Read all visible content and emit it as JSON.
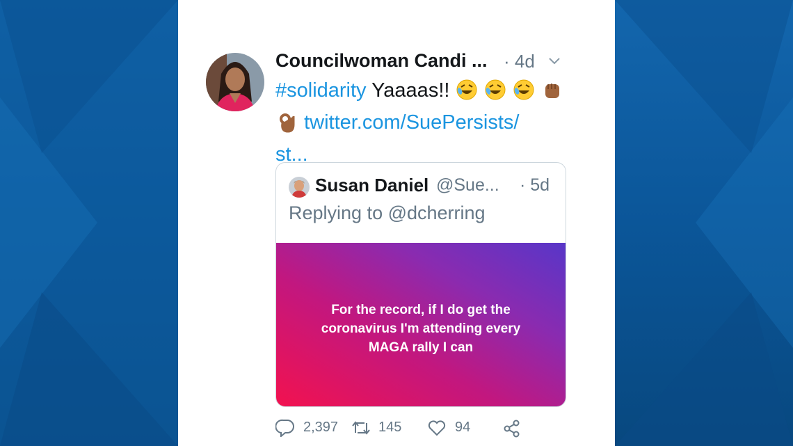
{
  "colors": {
    "brand_blue": "#1b95e0",
    "text_primary": "#14171a",
    "text_secondary": "#657786",
    "background": "#0b5699"
  },
  "tweet": {
    "author_name": "Councilwoman Candi ...",
    "time": "· 4d",
    "hashtag": "#solidarity",
    "text_after_hashtag": "Yaaaas!!",
    "emojis": [
      "rofl-emoji",
      "rofl-emoji",
      "rofl-emoji",
      "raised-fist-emoji",
      "ok-hand-emoji"
    ],
    "link_line1": "twitter.com/SuePersists/",
    "link_line2": "st..."
  },
  "quoted_tweet": {
    "name": "Susan Daniel",
    "handle": "@Sue...",
    "time": "· 5d",
    "replying_to": "Replying to @dcherring",
    "media_text": [
      "For the record, if I do get the",
      "coronavirus I'm attending every",
      "MAGA rally I can"
    ]
  },
  "actions": {
    "reply_count": "2,397",
    "retweet_count": "145",
    "like_count": "94"
  },
  "icons": {
    "reply": "reply-icon",
    "retweet": "retweet-icon",
    "like": "heart-icon",
    "share": "share-icon",
    "more": "chevron-down-icon"
  }
}
